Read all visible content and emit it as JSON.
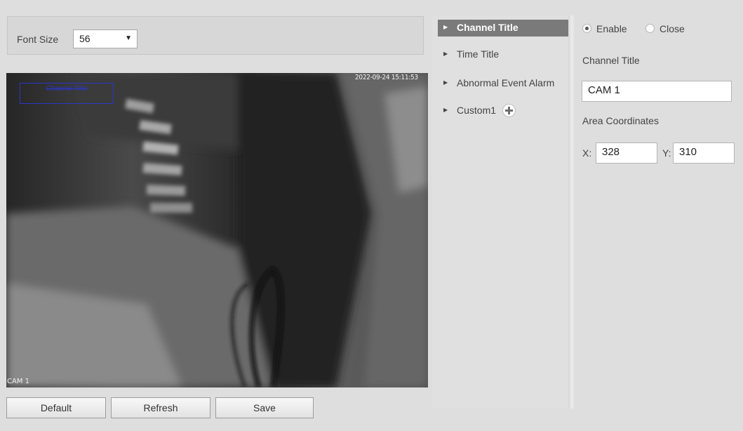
{
  "font_size": {
    "label": "Font Size",
    "selected": "56"
  },
  "video": {
    "osd_channel_title": "Channel Title",
    "osd_timestamp": "2022-09-24 15:11:53",
    "osd_camera_name": "CAM 1"
  },
  "buttons": {
    "default_label": "Default",
    "refresh_label": "Refresh",
    "save_label": "Save"
  },
  "menu": {
    "items": [
      {
        "label": "Channel Title",
        "active": true
      },
      {
        "label": "Time Title",
        "active": false
      },
      {
        "label": "Abnormal Event Alarm",
        "active": false
      },
      {
        "label": "Custom1",
        "active": false
      }
    ],
    "add_icon": "plus-icon"
  },
  "settings": {
    "enable_label": "Enable",
    "close_label": "Close",
    "state": "Enable",
    "channel_title_label": "Channel Title",
    "channel_title_value": "CAM 1",
    "area_coordinates_label": "Area Coordinates",
    "x_label": "X:",
    "x_value": "328",
    "y_label": "Y:",
    "y_value": "310"
  },
  "colors": {
    "osd_box": "#2a36c8",
    "active_menu": "#7a7a7a",
    "background": "#dedede"
  }
}
